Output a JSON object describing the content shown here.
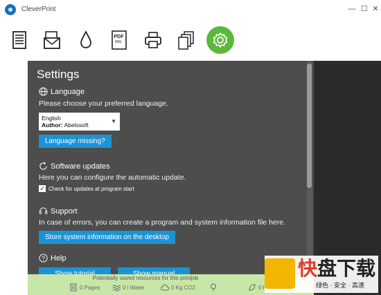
{
  "window": {
    "title": "CleverPrint",
    "minimize": "—",
    "maximize": "☐",
    "close": "✕"
  },
  "toolbar": {
    "items": [
      {
        "name": "document",
        "icon": "document-icon"
      },
      {
        "name": "email",
        "icon": "envelope-icon"
      },
      {
        "name": "ink",
        "icon": "ink-drop-icon"
      },
      {
        "name": "pdf",
        "icon": "pdf-img-icon",
        "label_top": "PDF",
        "label_bottom": "IMG"
      },
      {
        "name": "print",
        "icon": "printer-icon"
      },
      {
        "name": "copies",
        "icon": "copies-icon"
      },
      {
        "name": "settings",
        "icon": "gear-icon",
        "active": true
      }
    ],
    "active_color": "#5cb83a"
  },
  "settings": {
    "title": "Settings",
    "language": {
      "header": "Language",
      "description": "Please choose your preferred language.",
      "selected_language": "English",
      "author_label": "Author:",
      "author_value": "Abelssoft",
      "missing_button": "Language missing?"
    },
    "updates": {
      "header": "Software updates",
      "description": "Here you can configure the automatic update.",
      "checkbox_label": "Check for updates at program start",
      "checkbox_checked": true
    },
    "support": {
      "header": "Support",
      "description": "In case of errors, you can create a program and system information file here.",
      "store_button": "Store system information on the desktop"
    },
    "help": {
      "header": "Help",
      "tutorial_button": "Show tutorial",
      "manual_button": "Show manual"
    }
  },
  "footer": {
    "title": "Potentially saved resources for this printjob",
    "pages": "0 Pages",
    "water": "0 l Water",
    "co2": "0 Kg CO2",
    "last": "0 K"
  },
  "watermark": {
    "big_left": "快",
    "big_right": "盘下载",
    "small": "绿色 · 安全 · 高速"
  },
  "colors": {
    "panel_bg": "#4d4d4d",
    "button_blue": "#1a94d6",
    "footer_green": "#c8e6a8",
    "right_band": "#2b2b2b"
  }
}
